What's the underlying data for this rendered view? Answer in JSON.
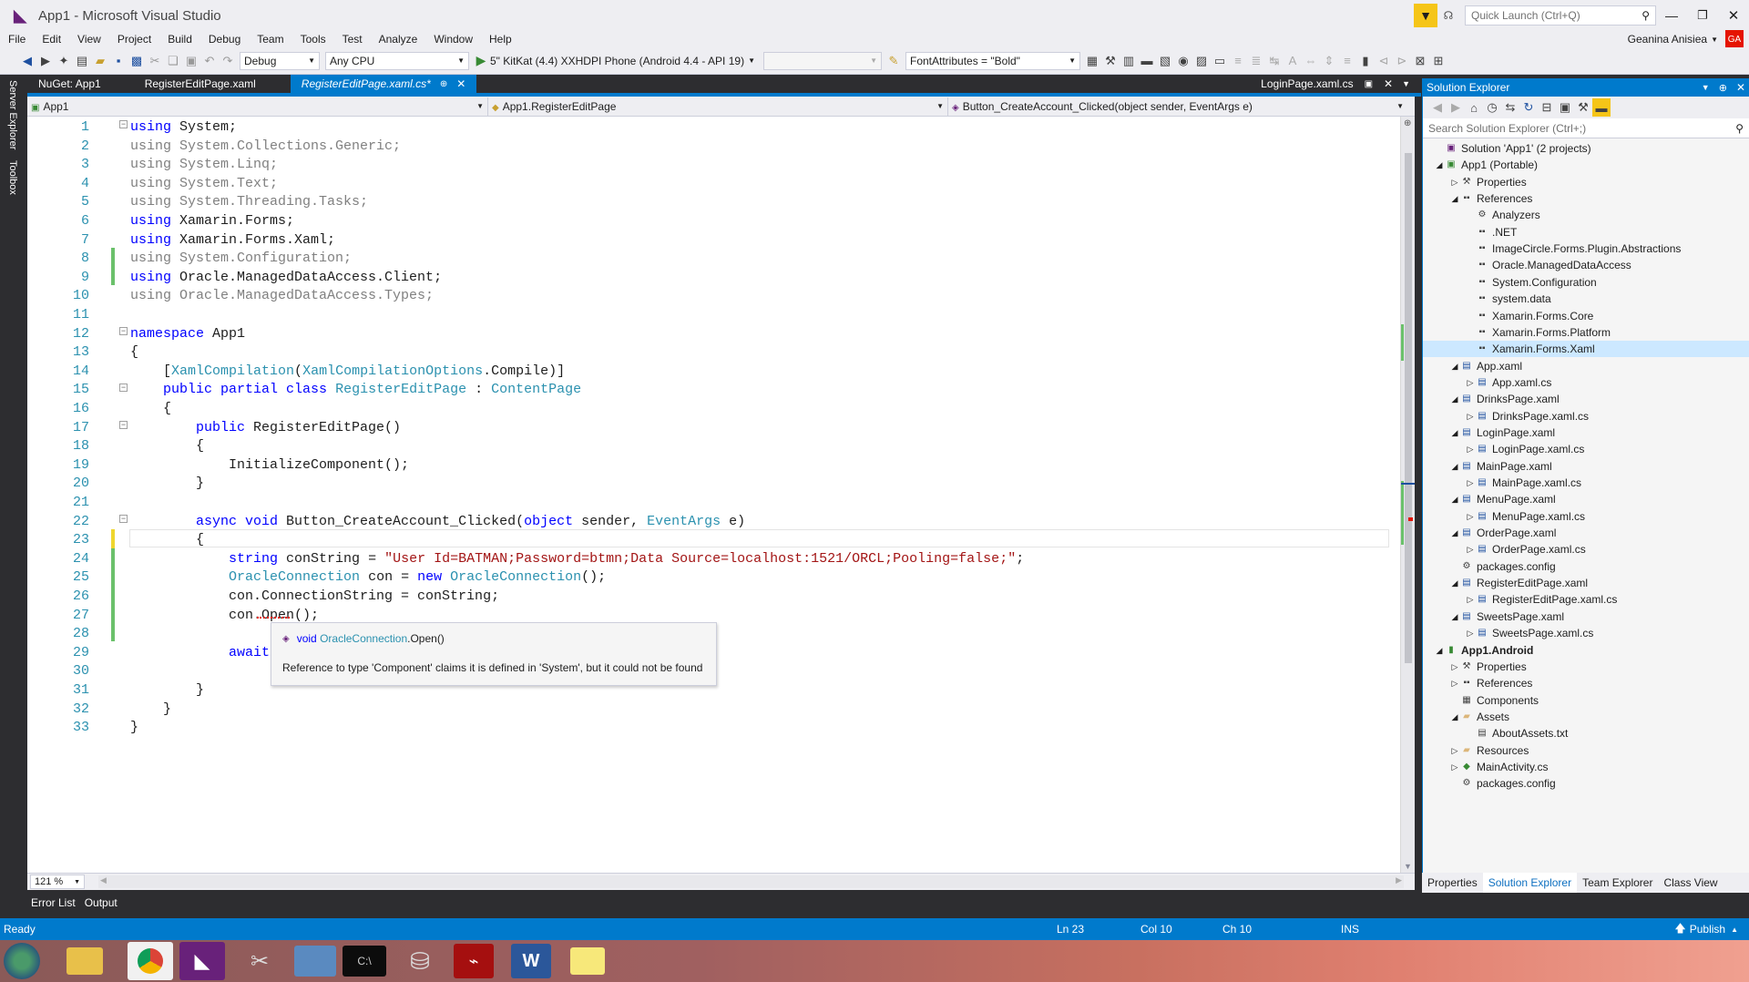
{
  "window": {
    "title": "App1 - Microsoft Visual Studio",
    "quick_launch_placeholder": "Quick Launch (Ctrl+Q)",
    "user": "Geanina Anisiea",
    "user_initials": "GA"
  },
  "menu": [
    "File",
    "Edit",
    "View",
    "Project",
    "Build",
    "Debug",
    "Team",
    "Tools",
    "Test",
    "Analyze",
    "Window",
    "Help"
  ],
  "toolbar": {
    "config": "Debug",
    "platform": "Any CPU",
    "run_target": "5\" KitKat (4.4) XXHDPI Phone (Android 4.4 - API 19)",
    "property_value": "FontAttributes = \"Bold\""
  },
  "left_strip": [
    "Server Explorer",
    "Toolbox"
  ],
  "doc_tabs": [
    {
      "label": "NuGet: App1"
    },
    {
      "label": "RegisterEditPage.xaml"
    },
    {
      "label": "RegisterEditPage.xaml.cs*"
    },
    {
      "label": "LoginPage.xaml.cs"
    }
  ],
  "nav": {
    "project": "App1",
    "class": "App1.RegisterEditPage",
    "member": "Button_CreateAccount_Clicked(object sender, EventArgs e)"
  },
  "code_lines": [
    {
      "n": "1",
      "segs": [
        [
          "kw",
          "using"
        ],
        [
          "",
          ""
        ],
        [
          "",
          " System;"
        ]
      ]
    },
    {
      "n": "2",
      "segs": [
        [
          "gr",
          "using System.Collections.Generic;"
        ]
      ]
    },
    {
      "n": "3",
      "segs": [
        [
          "gr",
          "using System.Linq;"
        ]
      ]
    },
    {
      "n": "4",
      "segs": [
        [
          "gr",
          "using System.Text;"
        ]
      ]
    },
    {
      "n": "5",
      "segs": [
        [
          "gr",
          "using System.Threading.Tasks;"
        ]
      ]
    },
    {
      "n": "6",
      "segs": [
        [
          "kw",
          "using"
        ],
        [
          "",
          " Xamarin.Forms;"
        ]
      ]
    },
    {
      "n": "7",
      "segs": [
        [
          "kw",
          "using"
        ],
        [
          "",
          " Xamarin.Forms.Xaml;"
        ]
      ]
    },
    {
      "n": "8",
      "segs": [
        [
          "gr",
          "using System.Configuration;"
        ]
      ]
    },
    {
      "n": "9",
      "segs": [
        [
          "kw",
          "using"
        ],
        [
          "",
          " Oracle.ManagedDataAccess.Client;"
        ]
      ]
    },
    {
      "n": "10",
      "segs": [
        [
          "gr",
          "using Oracle.ManagedDataAccess.Types;"
        ]
      ]
    },
    {
      "n": "11",
      "segs": []
    },
    {
      "n": "12",
      "segs": [
        [
          "kw",
          "namespace"
        ],
        [
          "",
          " App1"
        ]
      ]
    },
    {
      "n": "13",
      "segs": [
        [
          "",
          "{"
        ]
      ]
    },
    {
      "n": "14",
      "segs": [
        [
          "",
          "    ["
        ],
        [
          "ty",
          "XamlCompilation"
        ],
        [
          "",
          "("
        ],
        [
          "ty",
          "XamlCompilationOptions"
        ],
        [
          "",
          ".Compile)]"
        ]
      ]
    },
    {
      "n": "15",
      "segs": [
        [
          "",
          "    "
        ],
        [
          "kw",
          "public partial class"
        ],
        [
          "",
          " "
        ],
        [
          "ty",
          "RegisterEditPage"
        ],
        [
          "",
          " : "
        ],
        [
          "ty",
          "ContentPage"
        ]
      ]
    },
    {
      "n": "16",
      "segs": [
        [
          "",
          "    {"
        ]
      ]
    },
    {
      "n": "17",
      "segs": [
        [
          "",
          "        "
        ],
        [
          "kw",
          "public"
        ],
        [
          "",
          " RegisterEditPage()"
        ]
      ]
    },
    {
      "n": "18",
      "segs": [
        [
          "",
          "        {"
        ]
      ]
    },
    {
      "n": "19",
      "segs": [
        [
          "",
          "            InitializeComponent();"
        ]
      ]
    },
    {
      "n": "20",
      "segs": [
        [
          "",
          "        }"
        ]
      ]
    },
    {
      "n": "21",
      "segs": []
    },
    {
      "n": "22",
      "segs": [
        [
          "",
          "        "
        ],
        [
          "kw",
          "async void"
        ],
        [
          "",
          " Button_CreateAccount_Clicked("
        ],
        [
          "kw",
          "object"
        ],
        [
          "",
          " sender, "
        ],
        [
          "ty",
          "EventArgs"
        ],
        [
          "",
          " e)"
        ]
      ]
    },
    {
      "n": "23",
      "segs": [
        [
          "",
          "        {"
        ]
      ]
    },
    {
      "n": "24",
      "segs": [
        [
          "",
          "            "
        ],
        [
          "kw",
          "string"
        ],
        [
          "",
          " conString = "
        ],
        [
          "st",
          "\"User Id=BATMAN;Password=btmn;Data Source=localhost:1521/ORCL;Pooling=false;\""
        ],
        [
          "",
          ";"
        ]
      ]
    },
    {
      "n": "25",
      "segs": [
        [
          "",
          "            "
        ],
        [
          "ty",
          "OracleConnection"
        ],
        [
          "",
          " con = "
        ],
        [
          "kw",
          "new"
        ],
        [
          "",
          " "
        ],
        [
          "ty",
          "OracleConnection"
        ],
        [
          "",
          "();"
        ]
      ]
    },
    {
      "n": "26",
      "segs": [
        [
          "",
          "            con.ConnectionString = conString;"
        ]
      ]
    },
    {
      "n": "27",
      "segs": [
        [
          "",
          "            con.Open();"
        ]
      ]
    },
    {
      "n": "28",
      "segs": []
    },
    {
      "n": "29",
      "segs": [
        [
          "",
          "            "
        ],
        [
          "kw",
          "await"
        ]
      ]
    },
    {
      "n": "30",
      "segs": []
    },
    {
      "n": "31",
      "segs": [
        [
          "",
          "        }"
        ]
      ]
    },
    {
      "n": "32",
      "segs": [
        [
          "",
          "    }"
        ]
      ]
    },
    {
      "n": "33",
      "segs": [
        [
          "",
          "}"
        ]
      ]
    }
  ],
  "tooltip": {
    "signature_void": "void",
    "signature_type": "OracleConnection",
    "signature_method": ".Open()",
    "message": "Reference to type 'Component' claims it is defined in 'System', but it could not be found"
  },
  "editor_footer": {
    "zoom": "121 %"
  },
  "bottom_tabs": [
    "Error List",
    "Output"
  ],
  "solution_explorer": {
    "title": "Solution Explorer",
    "search_placeholder": "Search Solution Explorer (Ctrl+;)",
    "items": [
      {
        "label": "Solution 'App1' (2 projects)",
        "lvl": 0,
        "caret": "",
        "icon": "solution"
      },
      {
        "label": "App1 (Portable)",
        "lvl": 0,
        "caret": "◢",
        "icon": "csproj"
      },
      {
        "label": "Properties",
        "lvl": 1,
        "caret": "▷",
        "icon": "wrench"
      },
      {
        "label": "References",
        "lvl": 1,
        "caret": "◢",
        "icon": "ref"
      },
      {
        "label": "Analyzers",
        "lvl": 2,
        "caret": "",
        "icon": "analyzer"
      },
      {
        "label": ".NET",
        "lvl": 2,
        "caret": "",
        "icon": "ref"
      },
      {
        "label": "ImageCircle.Forms.Plugin.Abstractions",
        "lvl": 2,
        "caret": "",
        "icon": "ref"
      },
      {
        "label": "Oracle.ManagedDataAccess",
        "lvl": 2,
        "caret": "",
        "icon": "ref"
      },
      {
        "label": "System.Configuration",
        "lvl": 2,
        "caret": "",
        "icon": "ref"
      },
      {
        "label": "system.data",
        "lvl": 2,
        "caret": "",
        "icon": "ref"
      },
      {
        "label": "Xamarin.Forms.Core",
        "lvl": 2,
        "caret": "",
        "icon": "ref"
      },
      {
        "label": "Xamarin.Forms.Platform",
        "lvl": 2,
        "caret": "",
        "icon": "ref"
      },
      {
        "label": "Xamarin.Forms.Xaml",
        "lvl": 2,
        "caret": "",
        "icon": "ref",
        "selected": true
      },
      {
        "label": "App.xaml",
        "lvl": 1,
        "caret": "◢",
        "icon": "xaml"
      },
      {
        "label": "App.xaml.cs",
        "lvl": 2,
        "caret": "▷",
        "icon": "cs"
      },
      {
        "label": "DrinksPage.xaml",
        "lvl": 1,
        "caret": "◢",
        "icon": "xaml"
      },
      {
        "label": "DrinksPage.xaml.cs",
        "lvl": 2,
        "caret": "▷",
        "icon": "cs"
      },
      {
        "label": "LoginPage.xaml",
        "lvl": 1,
        "caret": "◢",
        "icon": "xaml"
      },
      {
        "label": "LoginPage.xaml.cs",
        "lvl": 2,
        "caret": "▷",
        "icon": "cs"
      },
      {
        "label": "MainPage.xaml",
        "lvl": 1,
        "caret": "◢",
        "icon": "xaml"
      },
      {
        "label": "MainPage.xaml.cs",
        "lvl": 2,
        "caret": "▷",
        "icon": "cs"
      },
      {
        "label": "MenuPage.xaml",
        "lvl": 1,
        "caret": "◢",
        "icon": "xaml"
      },
      {
        "label": "MenuPage.xaml.cs",
        "lvl": 2,
        "caret": "▷",
        "icon": "cs"
      },
      {
        "label": "OrderPage.xaml",
        "lvl": 1,
        "caret": "◢",
        "icon": "xaml"
      },
      {
        "label": "OrderPage.xaml.cs",
        "lvl": 2,
        "caret": "▷",
        "icon": "cs"
      },
      {
        "label": "packages.config",
        "lvl": 1,
        "caret": "",
        "icon": "config"
      },
      {
        "label": "RegisterEditPage.xaml",
        "lvl": 1,
        "caret": "◢",
        "icon": "xaml"
      },
      {
        "label": "RegisterEditPage.xaml.cs",
        "lvl": 2,
        "caret": "▷",
        "icon": "cs"
      },
      {
        "label": "SweetsPage.xaml",
        "lvl": 1,
        "caret": "◢",
        "icon": "xaml"
      },
      {
        "label": "SweetsPage.xaml.cs",
        "lvl": 2,
        "caret": "▷",
        "icon": "cs"
      },
      {
        "label": "App1.Android",
        "lvl": 0,
        "caret": "◢",
        "icon": "android",
        "bold": true
      },
      {
        "label": "Properties",
        "lvl": 1,
        "caret": "▷",
        "icon": "wrench"
      },
      {
        "label": "References",
        "lvl": 1,
        "caret": "▷",
        "icon": "ref"
      },
      {
        "label": "Components",
        "lvl": 1,
        "caret": "",
        "icon": "component"
      },
      {
        "label": "Assets",
        "lvl": 1,
        "caret": "◢",
        "icon": "folder"
      },
      {
        "label": "AboutAssets.txt",
        "lvl": 2,
        "caret": "",
        "icon": "txt"
      },
      {
        "label": "Resources",
        "lvl": 1,
        "caret": "▷",
        "icon": "folder"
      },
      {
        "label": "MainActivity.cs",
        "lvl": 1,
        "caret": "▷",
        "icon": "csclass"
      },
      {
        "label": "packages.config",
        "lvl": 1,
        "caret": "",
        "icon": "config"
      }
    ],
    "bottom_tabs": [
      "Properties",
      "Solution Explorer",
      "Team Explorer",
      "Class View"
    ]
  },
  "status": {
    "ready": "Ready",
    "ln": "Ln 23",
    "col": "Col 10",
    "ch": "Ch 10",
    "ins": "INS",
    "publish": "Publish"
  },
  "colors": {
    "accent": "#007acc",
    "keyword": "#0000ff",
    "type": "#2b91af",
    "string": "#a31515",
    "comment_gray": "#808080",
    "change_green": "#6bc16b",
    "change_yellow": "#efd62e",
    "error_red": "#e51400"
  }
}
